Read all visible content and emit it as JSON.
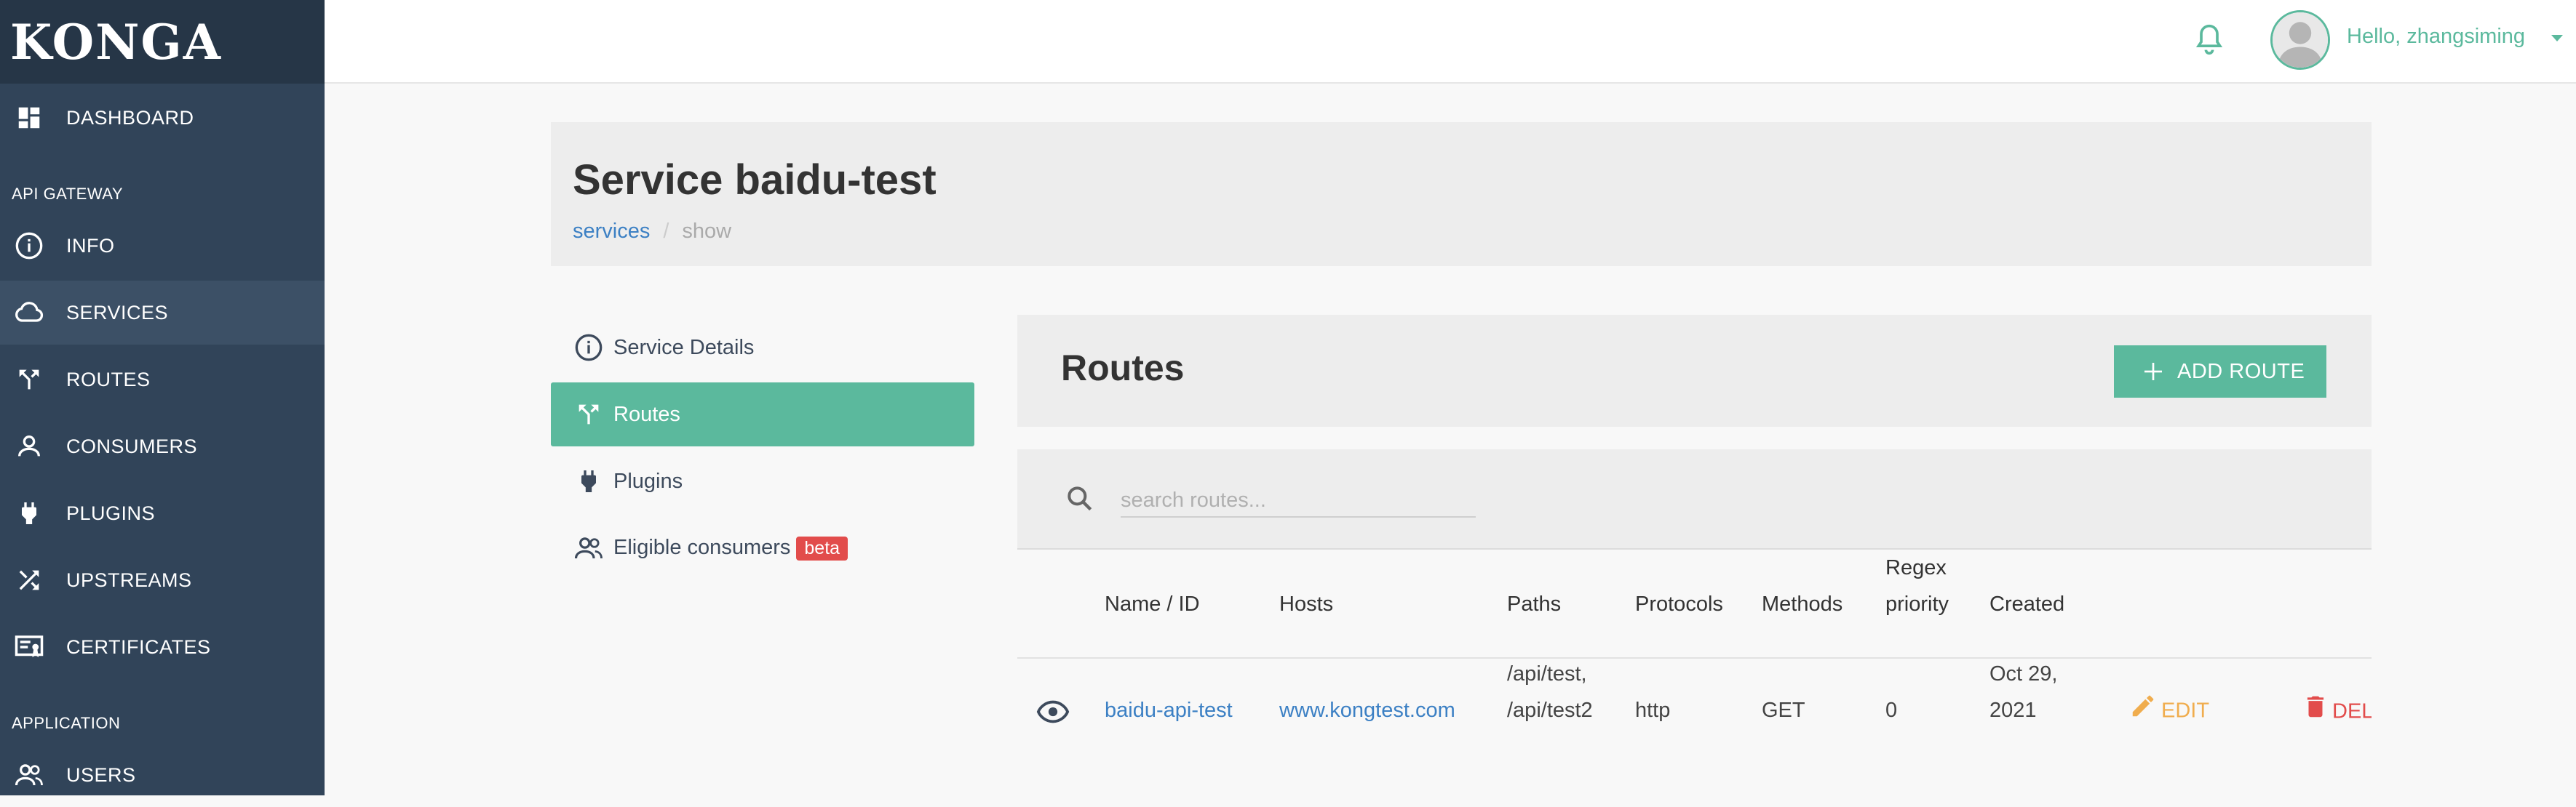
{
  "app": {
    "logo": "KONGA"
  },
  "sidebar": {
    "items": [
      {
        "label": "DASHBOARD",
        "icon": "dashboard-icon"
      },
      {
        "section": "API GATEWAY"
      },
      {
        "label": "INFO",
        "icon": "info-icon"
      },
      {
        "label": "SERVICES",
        "icon": "cloud-icon",
        "active": true
      },
      {
        "label": "ROUTES",
        "icon": "fork-icon"
      },
      {
        "label": "CONSUMERS",
        "icon": "person-icon"
      },
      {
        "label": "PLUGINS",
        "icon": "plug-icon"
      },
      {
        "label": "UPSTREAMS",
        "icon": "shuffle-icon"
      },
      {
        "label": "CERTIFICATES",
        "icon": "certificate-icon"
      },
      {
        "section": "APPLICATION"
      },
      {
        "label": "USERS",
        "icon": "users-icon"
      }
    ]
  },
  "topbar": {
    "greeting": "Hello, zhangsiming"
  },
  "header": {
    "title": "Service baidu-test",
    "breadcrumb": {
      "link": "services",
      "separator": "/",
      "current": "show"
    }
  },
  "menu": {
    "items": [
      {
        "label": "Service Details",
        "icon": "info-icon"
      },
      {
        "label": "Routes",
        "icon": "fork-icon",
        "active": true
      },
      {
        "label": "Plugins",
        "icon": "plug-icon"
      },
      {
        "label": "Eligible consumers",
        "icon": "users-icon",
        "badge": "beta"
      }
    ]
  },
  "routes": {
    "title": "Routes",
    "add_label": "ADD ROUTE",
    "search_placeholder": "search routes...",
    "columns": [
      "Name / ID",
      "Hosts",
      "Paths",
      "Protocols",
      "Methods",
      "Regex",
      "priority",
      "Created"
    ],
    "rows": [
      {
        "name": "baidu-api-test",
        "hosts": "www.kongtest.com",
        "paths": [
          "/api/test,",
          "/api/test2"
        ],
        "protocols": "http",
        "methods": "GET",
        "regex_priority": "0",
        "created": [
          "Oct 29,",
          "2021"
        ],
        "edit_label": "EDIT",
        "delete_label": "DELETE"
      }
    ]
  },
  "colors": {
    "sidebar": "#314459",
    "accent": "#5bb99d",
    "link": "#3c80c4",
    "edit": "#f0ad4e",
    "danger": "#e24c4b"
  }
}
